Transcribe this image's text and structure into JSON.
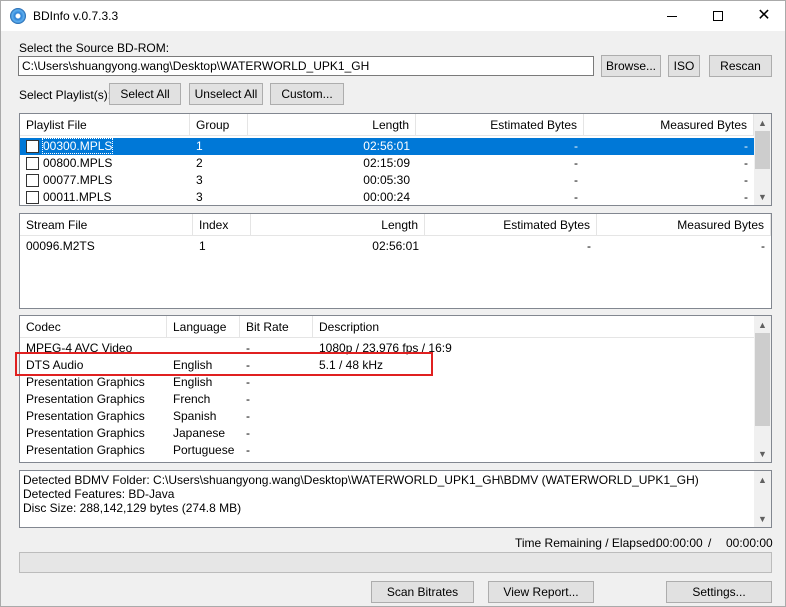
{
  "window": {
    "title": "BDInfo v.0.7.3.3"
  },
  "source": {
    "label": "Select the Source BD-ROM:",
    "path": "C:\\Users\\shuangyong.wang\\Desktop\\WATERWORLD_UPK1_GH",
    "browse": "Browse...",
    "iso": "ISO",
    "rescan": "Rescan"
  },
  "playlist_controls": {
    "label": "Select Playlist(s):",
    "select_all": "Select All",
    "unselect_all": "Unselect All",
    "custom": "Custom..."
  },
  "playlists": {
    "headers": [
      "Playlist File",
      "Group",
      "Length",
      "Estimated Bytes",
      "Measured Bytes"
    ],
    "rows": [
      {
        "file": "00300.MPLS",
        "group": "1",
        "length": "02:56:01",
        "est": "-",
        "meas": "-",
        "selected": true
      },
      {
        "file": "00800.MPLS",
        "group": "2",
        "length": "02:15:09",
        "est": "-",
        "meas": "-"
      },
      {
        "file": "00077.MPLS",
        "group": "3",
        "length": "00:05:30",
        "est": "-",
        "meas": "-"
      },
      {
        "file": "00011.MPLS",
        "group": "3",
        "length": "00:00:24",
        "est": "-",
        "meas": "-"
      }
    ]
  },
  "streams": {
    "headers": [
      "Stream File",
      "Index",
      "Length",
      "Estimated Bytes",
      "Measured Bytes"
    ],
    "rows": [
      {
        "file": "00096.M2TS",
        "index": "1",
        "length": "02:56:01",
        "est": "-",
        "meas": "-"
      }
    ]
  },
  "codecs": {
    "headers": [
      "Codec",
      "Language",
      "Bit Rate",
      "Description"
    ],
    "rows": [
      {
        "codec": "MPEG-4 AVC Video",
        "language": "",
        "bitrate": "-",
        "description": "1080p / 23.976 fps / 16:9"
      },
      {
        "codec": "DTS Audio",
        "language": "English",
        "bitrate": "-",
        "description": "5.1 / 48 kHz"
      },
      {
        "codec": "Presentation Graphics",
        "language": "English",
        "bitrate": "-",
        "description": ""
      },
      {
        "codec": "Presentation Graphics",
        "language": "French",
        "bitrate": "-",
        "description": ""
      },
      {
        "codec": "Presentation Graphics",
        "language": "Spanish",
        "bitrate": "-",
        "description": ""
      },
      {
        "codec": "Presentation Graphics",
        "language": "Japanese",
        "bitrate": "-",
        "description": ""
      },
      {
        "codec": "Presentation Graphics",
        "language": "Portuguese",
        "bitrate": "-",
        "description": ""
      }
    ]
  },
  "info": {
    "lines": [
      "Detected BDMV Folder: C:\\Users\\shuangyong.wang\\Desktop\\WATERWORLD_UPK1_GH\\BDMV (WATERWORLD_UPK1_GH)",
      "Detected Features: BD-Java",
      "Disc Size: 288,142,129 bytes (274.8 MB)"
    ]
  },
  "status": {
    "label": "Time Remaining / Elapsed:",
    "remaining": "00:00:00",
    "separator": "/",
    "elapsed": "00:00:00",
    "progress": 0
  },
  "footer": {
    "scan_bitrates": "Scan Bitrates",
    "view_report": "View Report...",
    "settings": "Settings..."
  },
  "colors": {
    "selection": "#0078d7",
    "highlight_box": "#e02020"
  }
}
